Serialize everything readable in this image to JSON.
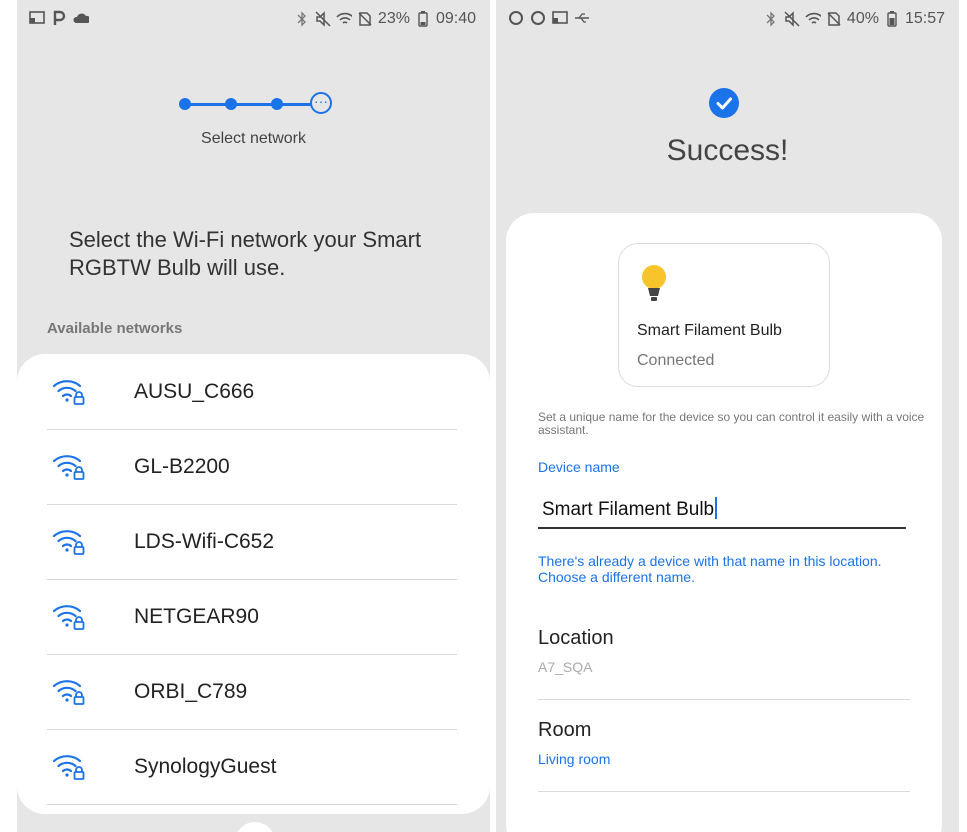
{
  "left": {
    "status": {
      "battery": "23%",
      "time": "09:40"
    },
    "step_label": "Select network",
    "prompt": "Select the Wi-Fi network your Smart RGBTW Bulb will use.",
    "section_label": "Available networks",
    "networks": [
      "AUSU_C666",
      "GL-B2200",
      "LDS-Wifi-C652",
      "NETGEAR90",
      "ORBI_C789",
      "SynologyGuest"
    ]
  },
  "right": {
    "status": {
      "battery": "40%",
      "time": "15:57"
    },
    "title": "Success!",
    "device": {
      "name": "Smart Filament Bulb",
      "status": "Connected"
    },
    "hint": "Set a unique name for the device so you can control it easily with a voice assistant.",
    "field_label": "Device name",
    "device_name_value": "Smart Filament Bulb",
    "error": "There's already a device with that name in this location. Choose a different name.",
    "location": {
      "label": "Location",
      "value": "A7_SQA"
    },
    "room": {
      "label": "Room",
      "value": "Living room"
    }
  },
  "colors": {
    "accent": "#1a73e8",
    "bulb": "#f7c52b",
    "background": "#e6e6e6"
  }
}
